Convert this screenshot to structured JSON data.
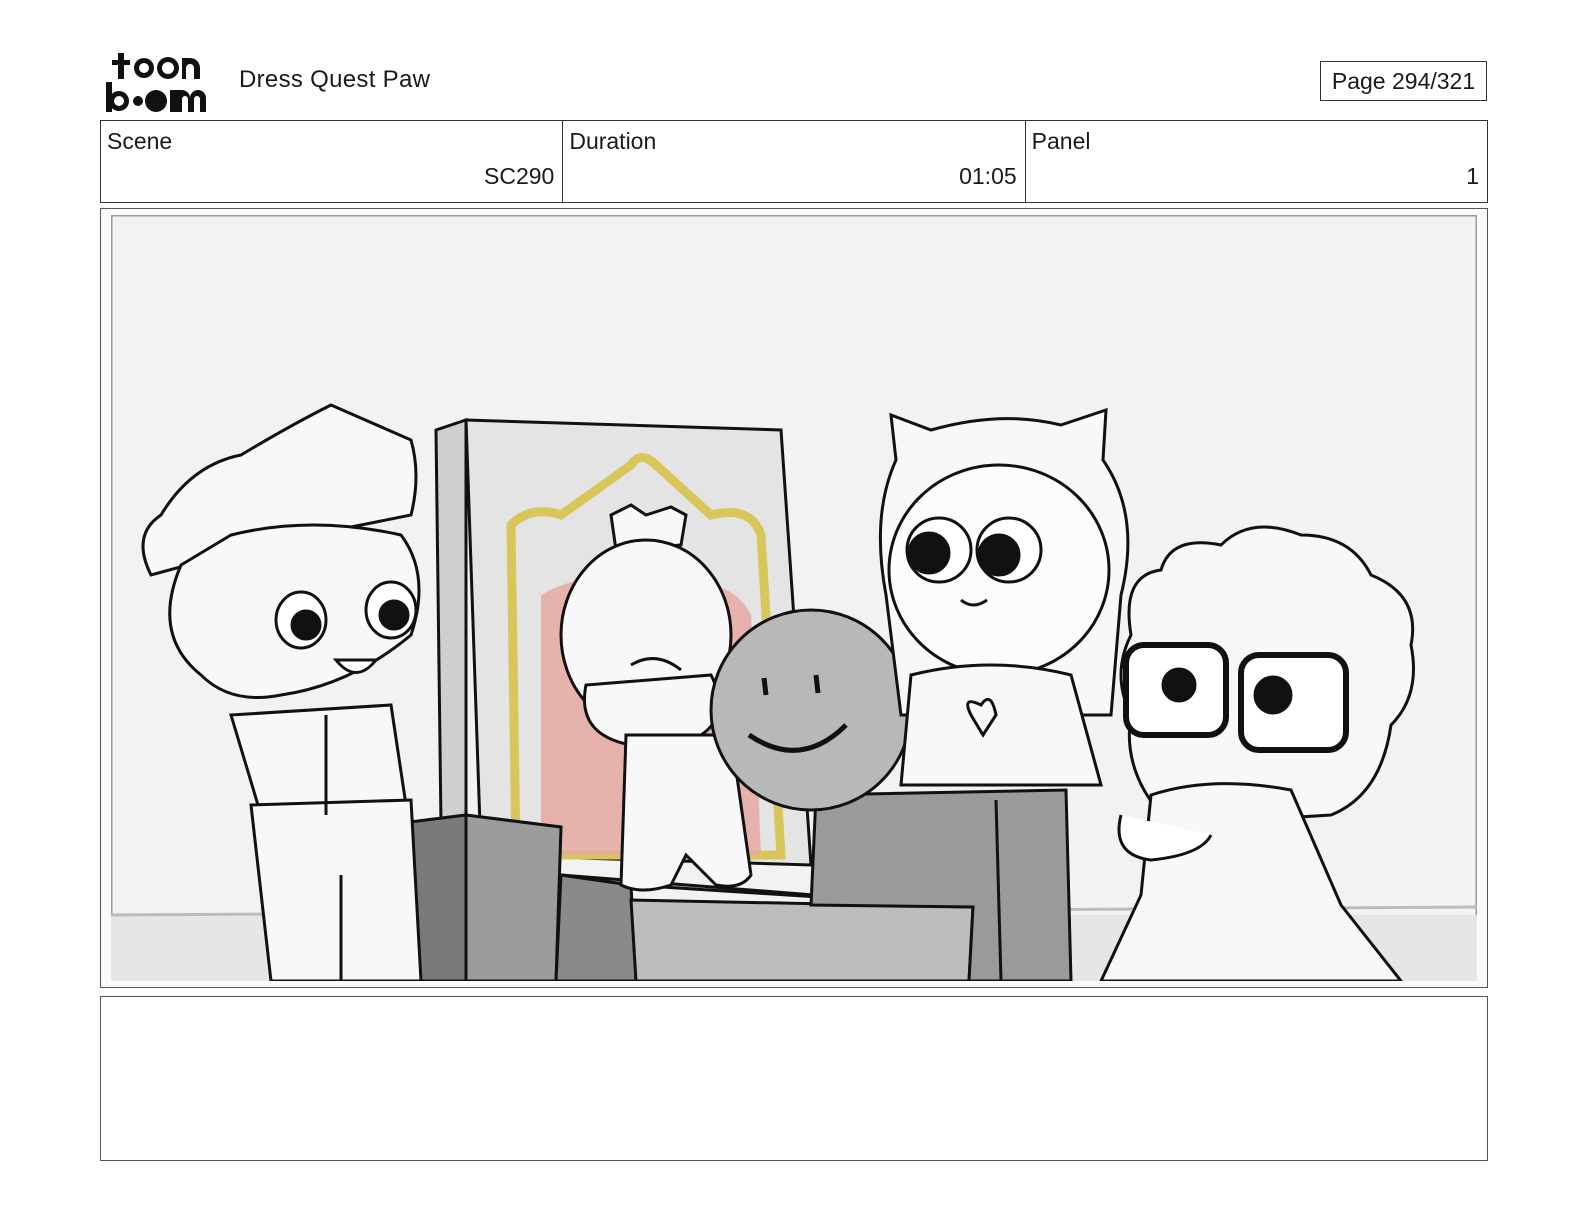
{
  "header": {
    "logo_top": "toon",
    "logo_bottom": "boom",
    "project_title": "Dress Quest Paw",
    "page_indicator": "Page 294/321"
  },
  "info": {
    "scene_label": "Scene",
    "scene_value": "SC290",
    "duration_label": "Duration",
    "duration_value": "01:05",
    "panel_label": "Panel",
    "panel_value": "1"
  },
  "panel": {
    "image_name": "storyboard-drawing"
  },
  "notes": {
    "text": ""
  }
}
